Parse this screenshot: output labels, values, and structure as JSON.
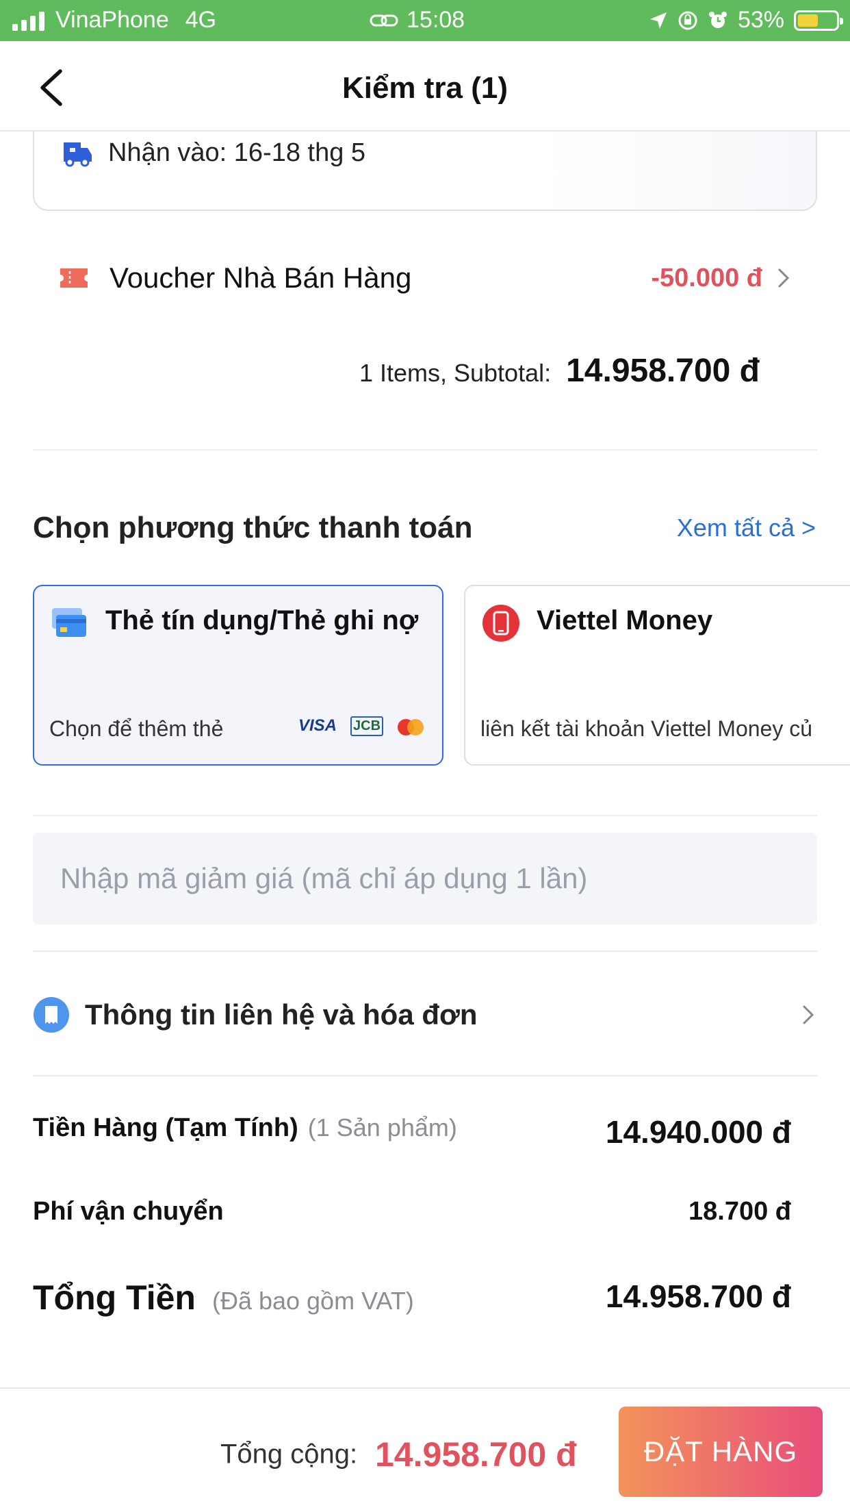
{
  "status_bar": {
    "carrier": "VinaPhone",
    "network": "4G",
    "time": "15:08",
    "battery": "53%",
    "battery_level": 0.53
  },
  "header": {
    "title": "Kiểm tra (1)"
  },
  "delivery": {
    "text": "Nhận vào: 16-18 thg 5"
  },
  "voucher": {
    "label": "Voucher Nhà Bán Hàng",
    "value": "-50.000 đ"
  },
  "subtotal": {
    "label": "1 Items, Subtotal:",
    "value": "14.958.700 đ"
  },
  "payment": {
    "title": "Chọn phương thức thanh toán",
    "see_all": "Xem tất cả >",
    "methods": [
      {
        "title": "Thẻ tín dụng/Thẻ ghi nợ",
        "subtitle": "Chọn để thêm thẻ",
        "brands": [
          "VISA",
          "JCB"
        ]
      },
      {
        "title": "Viettel Money",
        "subtitle": "liên kết tài khoản Viettel Money củ"
      }
    ]
  },
  "discount": {
    "placeholder": "Nhập mã giảm giá (mã chỉ áp dụng 1 lần)"
  },
  "contact": {
    "label": "Thông tin liên hệ và hóa đơn"
  },
  "summary": {
    "goods_label": "Tiền Hàng (Tạm Tính)",
    "goods_note": "(1 Sản phẩm)",
    "goods_value": "14.940.000 đ",
    "shipping_label": "Phí vận chuyển",
    "shipping_value": "18.700 đ",
    "total_label": "Tổng Tiền",
    "total_note": "(Đã bao gồm VAT)",
    "total_value": "14.958.700 đ"
  },
  "footer": {
    "total_label": "Tổng cộng:",
    "total_value": "14.958.700 đ",
    "order_button": "ĐẶT HÀNG"
  },
  "colors": {
    "status_bar": "#5fbb5c",
    "accent_red": "#e0525e",
    "link_blue": "#2a6fd6",
    "selected_border": "#2f6de0"
  }
}
